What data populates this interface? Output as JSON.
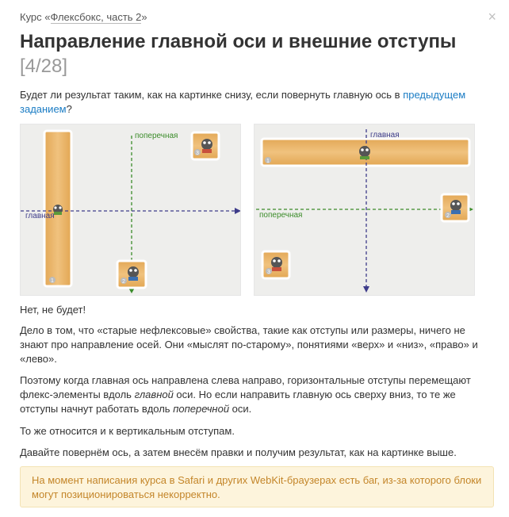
{
  "header": {
    "course_prefix": "Курс «",
    "course_link": "Флексбокс, часть 2",
    "course_suffix": "»",
    "close_icon": "close-icon",
    "title": "Направление главной оси и внешние отступы",
    "counter": "[4/28]"
  },
  "question": {
    "text": "Будет ли результат таким, как на картинке снизу, если повернуть главную ось в ",
    "link": "предыдущем заданием",
    "suffix": "?"
  },
  "figures": [
    {
      "cross_label": "поперечная",
      "main_label": "главная",
      "items": [
        "1",
        "2",
        "3"
      ]
    },
    {
      "main_label": "главная",
      "cross_label": "поперечная",
      "items": [
        "1",
        "2",
        "3"
      ]
    }
  ],
  "body": {
    "answer": "Нет, не будет!",
    "p1": "Дело в том, что «старые нефлексовые» свойства, такие как отступы или размеры, ничего не знают про направление осей. Они «мыслят по-старому», понятиями «верх» и «низ», «право» и «лево».",
    "p2_a": "Поэтому когда главная ось направлена слева направо, горизонтальные отступы перемещают флекс-элементы вдоль ",
    "p2_em1": "главной",
    "p2_b": " оси. Но если направить главную ось сверху вниз, то те же отступы начнут работать вдоль ",
    "p2_em2": "поперечной",
    "p2_c": " оси.",
    "p3": "То же относится и к вертикальным отступам.",
    "p4": "Давайте повернём ось, а затем внесём правки и получим результат, как на картинке выше."
  },
  "note": {
    "text": "На момент написания курса в Safari и других WebKit-браузерах есть баг, из-за которого блоки могут позиционироваться некорректно."
  },
  "colors": {
    "link": "#1a7cc4",
    "main_axis": "#3e3c8a",
    "cross_axis": "#3b8c2a",
    "wood": "#e8b468",
    "note_bg": "#fdf4dc",
    "note_text": "#c4862a"
  }
}
